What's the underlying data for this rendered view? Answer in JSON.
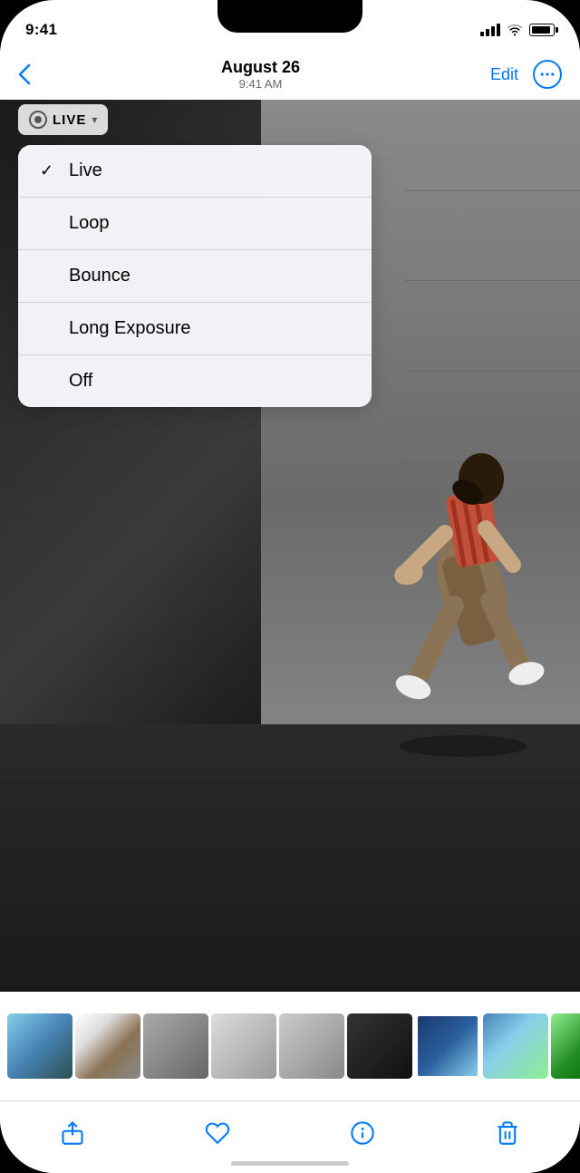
{
  "statusBar": {
    "time": "9:41",
    "batteryFull": true
  },
  "navBar": {
    "backLabel": "‹",
    "title": "August 26",
    "subtitle": "9:41 AM",
    "editLabel": "Edit",
    "moreLabel": "···"
  },
  "liveButton": {
    "label": "LIVE",
    "chevron": "▾"
  },
  "dropdownMenu": {
    "items": [
      {
        "label": "Live",
        "selected": true
      },
      {
        "label": "Loop",
        "selected": false
      },
      {
        "label": "Bounce",
        "selected": false
      },
      {
        "label": "Long Exposure",
        "selected": false
      },
      {
        "label": "Off",
        "selected": false
      }
    ]
  },
  "toolbar": {
    "shareLabel": "Share",
    "likeLabel": "Like",
    "infoLabel": "Info",
    "deleteLabel": "Delete"
  }
}
